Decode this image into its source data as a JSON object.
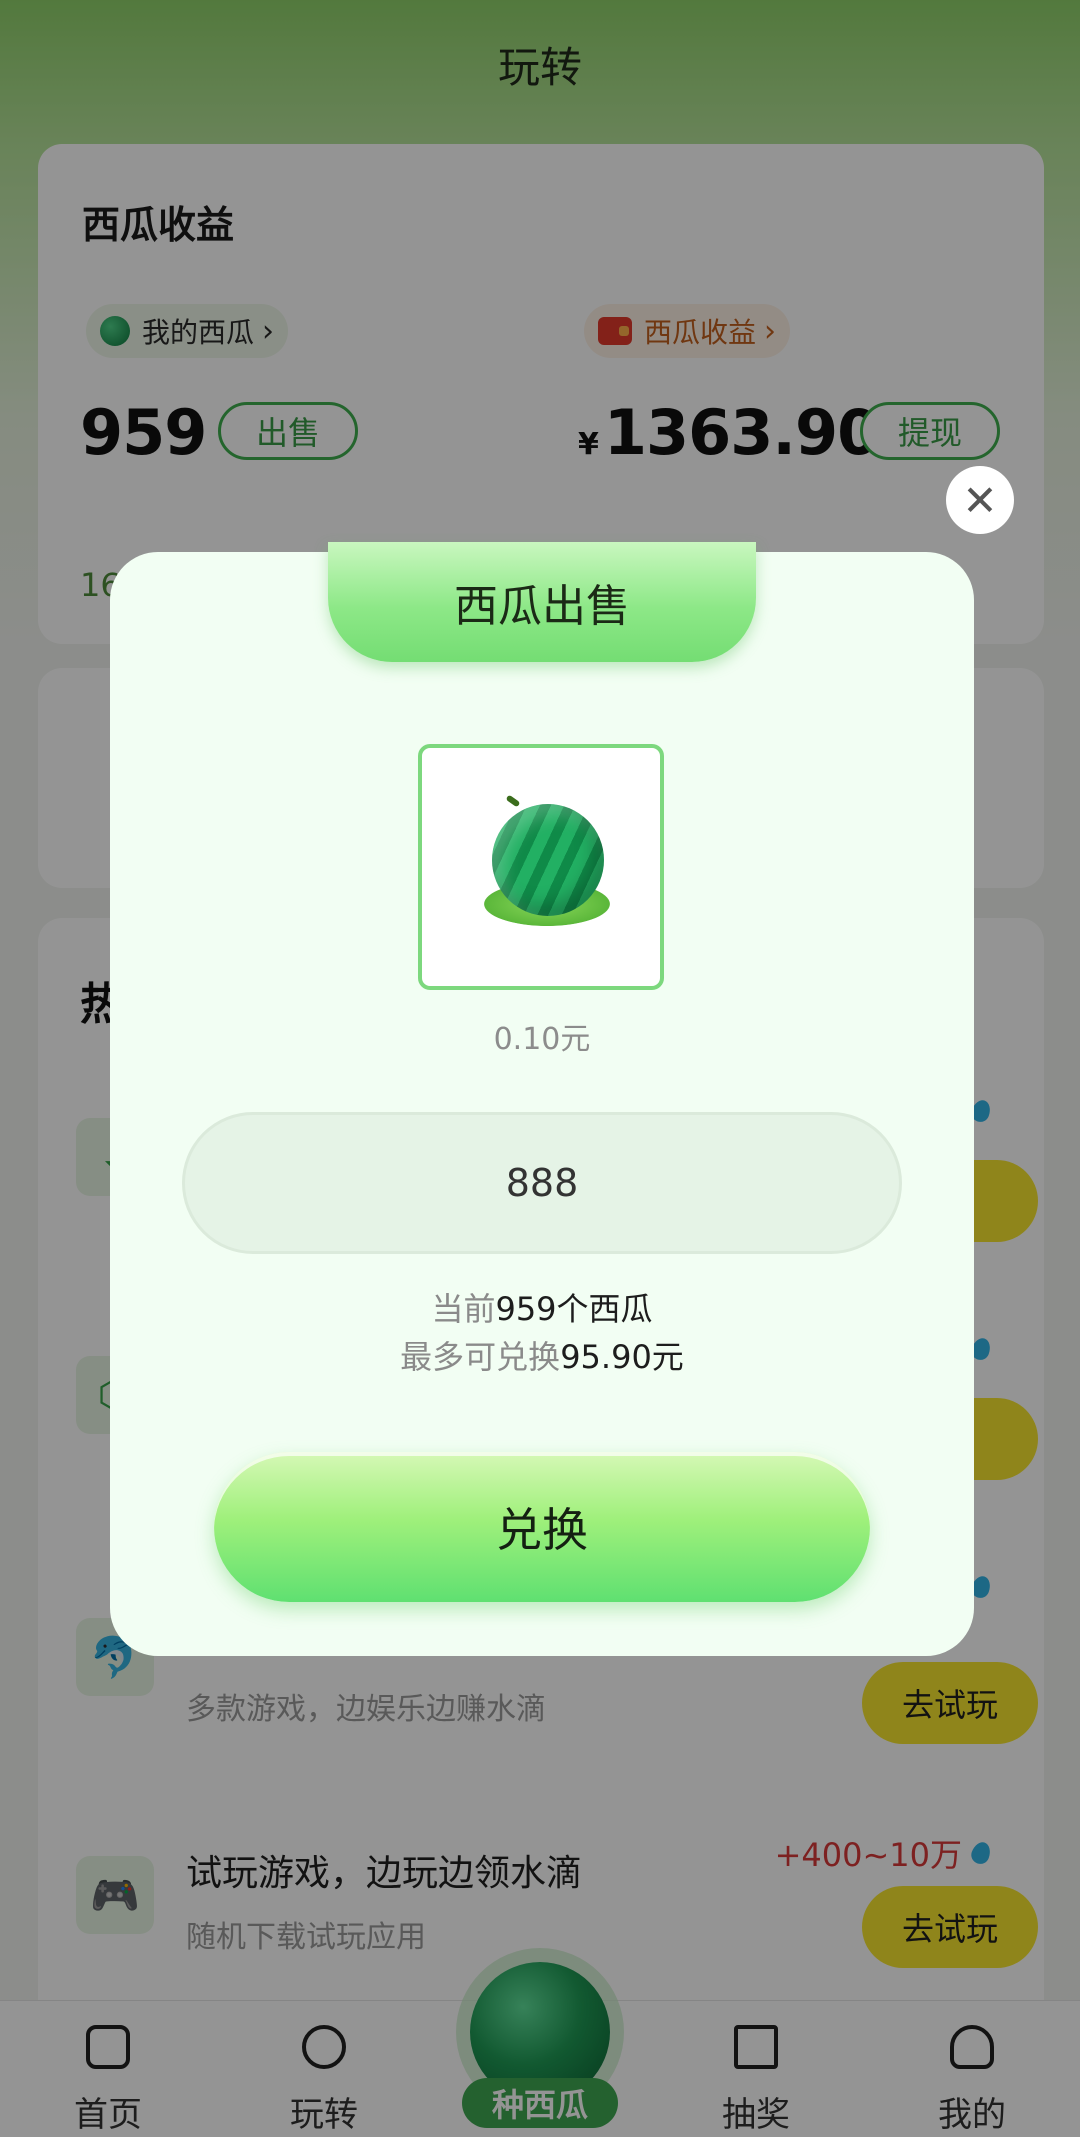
{
  "page": {
    "title": "玩转"
  },
  "earnings": {
    "title": "西瓜收益",
    "my_watermelon_label": "我的西瓜",
    "revenue_label": "西瓜收益",
    "watermelon_count": "959",
    "sell_label": "出售",
    "currency": "¥",
    "revenue_amount": "1363.90",
    "withdraw_label": "提现",
    "partial_text": "16"
  },
  "hot": {
    "title_partial": "热",
    "tasks": [
      {
        "title": "",
        "subtitle": "多款游戏，边娱乐边赚水滴",
        "reward": "",
        "button": "去试玩"
      },
      {
        "title": "试玩游戏，边玩边领水滴",
        "subtitle": "随机下载试玩应用",
        "reward": "+400~10万",
        "button": "去试玩"
      }
    ]
  },
  "tabbar": {
    "items": [
      {
        "label": "首页"
      },
      {
        "label": "玩转"
      },
      {
        "label": "种西瓜"
      },
      {
        "label": "抽奖"
      },
      {
        "label": "我的"
      }
    ]
  },
  "modal": {
    "title": "西瓜出售",
    "unit_price": "0.10元",
    "quantity_value": "888",
    "current_prefix": "当前",
    "current_value": "959个西瓜",
    "max_prefix": "最多可兑换",
    "max_value": "95.90元",
    "exchange_label": "兑换",
    "close_symbol": "✕"
  }
}
